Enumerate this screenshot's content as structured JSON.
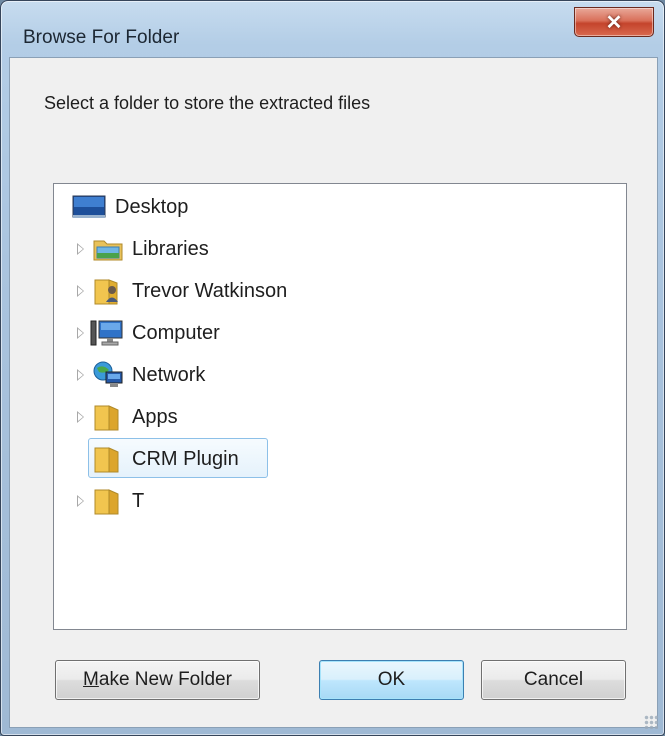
{
  "window": {
    "title": "Browse For Folder",
    "close_label": "✕"
  },
  "instruction": "Select a folder to store the extracted files",
  "tree": {
    "items": [
      {
        "label": "Desktop",
        "icon": "desktop-icon",
        "expandable": false
      },
      {
        "label": "Libraries",
        "icon": "libraries-icon",
        "expandable": true
      },
      {
        "label": "Trevor Watkinson",
        "icon": "user-folder-icon",
        "expandable": true
      },
      {
        "label": "Computer",
        "icon": "computer-icon",
        "expandable": true
      },
      {
        "label": "Network",
        "icon": "network-icon",
        "expandable": true
      },
      {
        "label": "Apps",
        "icon": "folder-icon",
        "expandable": true
      },
      {
        "label": "CRM Plugin",
        "icon": "folder-icon",
        "expandable": false,
        "selected": true
      },
      {
        "label": "T",
        "icon": "folder-icon",
        "expandable": true
      }
    ]
  },
  "buttons": {
    "make_new_folder_prefix": "M",
    "make_new_folder_rest": "ake New Folder",
    "ok": "OK",
    "cancel": "Cancel"
  },
  "colors": {
    "title_bar": "#b3cde6",
    "close_button": "#c4442c",
    "selection_border": "#8dc0e8",
    "default_button_border": "#3c7fb1",
    "folder_yellow": "#f1c54f"
  }
}
